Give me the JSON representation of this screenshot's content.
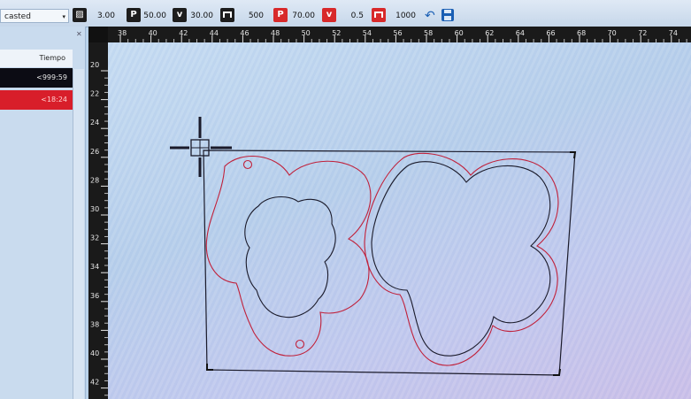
{
  "toolbar": {
    "material_value": "casted",
    "hatch_value": "3.00",
    "power1": "50.00",
    "speed1": "30.00",
    "freq1": "500",
    "power2": "70.00",
    "speed2": "0.5",
    "freq2": "1000",
    "icons": [
      "hatch-icon",
      "power-icon",
      "speed-icon",
      "frequency-icon",
      "power-icon",
      "speed-icon",
      "frequency-icon",
      "undo-icon",
      "save-icon"
    ],
    "p_label": "P",
    "v_label": "v"
  },
  "left_panel": {
    "column_header": "Tiempo",
    "row1_time": "<999:59",
    "row2_time": "<18:24",
    "row1_color": "#0c0c14",
    "row2_color": "#d81e2a"
  },
  "ruler_top": [
    "38",
    "40",
    "42",
    "44",
    "46",
    "48",
    "50",
    "52",
    "54",
    "56",
    "58",
    "60",
    "62",
    "64",
    "66",
    "68",
    "70",
    "72",
    "74"
  ],
  "ruler_left": [
    "20",
    "22",
    "24",
    "26",
    "28",
    "30",
    "32",
    "34",
    "36",
    "38",
    "40",
    "42"
  ],
  "colors": {
    "cut_line": "#c0203a",
    "engrave_line": "#1a1a2a",
    "accent": "#d8292a"
  }
}
